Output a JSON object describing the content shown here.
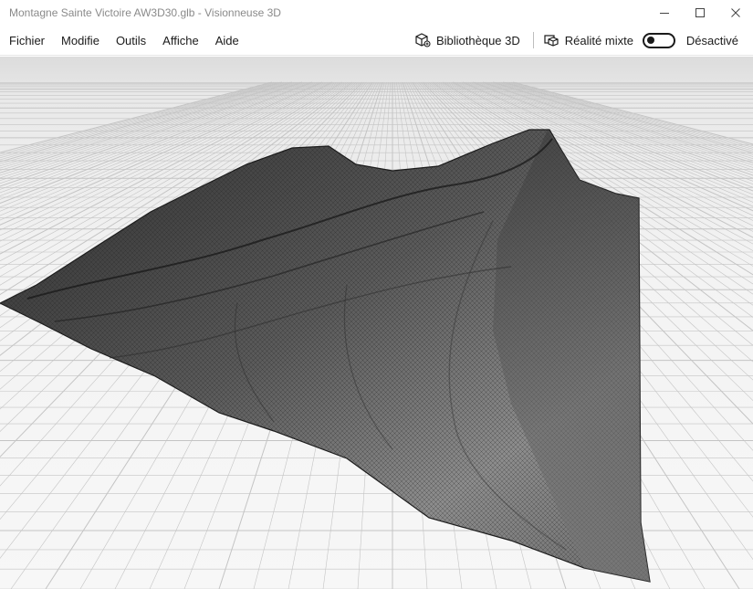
{
  "window": {
    "title": "Montagne Sainte Victoire AW3D30.glb - Visionneuse 3D",
    "controls": [
      "minimize-icon",
      "maximize-icon",
      "close-icon"
    ]
  },
  "menu": {
    "items": [
      {
        "label": "Fichier"
      },
      {
        "label": "Modifie"
      },
      {
        "label": "Outils"
      },
      {
        "label": "Affiche"
      },
      {
        "label": "Aide"
      }
    ]
  },
  "toolbar": {
    "library": {
      "label": "Bibliothèque 3D",
      "icon": "cube-library-icon"
    },
    "mixed_reality": {
      "label": "Réalité mixte",
      "icon": "mixed-reality-icon",
      "state": "Désactivé",
      "enabled": false
    }
  },
  "viewport": {
    "model": "mountain-terrain-wireframe",
    "grid": true,
    "background_color": "#f2f2f2",
    "mesh_color": "#3a3a3a"
  }
}
